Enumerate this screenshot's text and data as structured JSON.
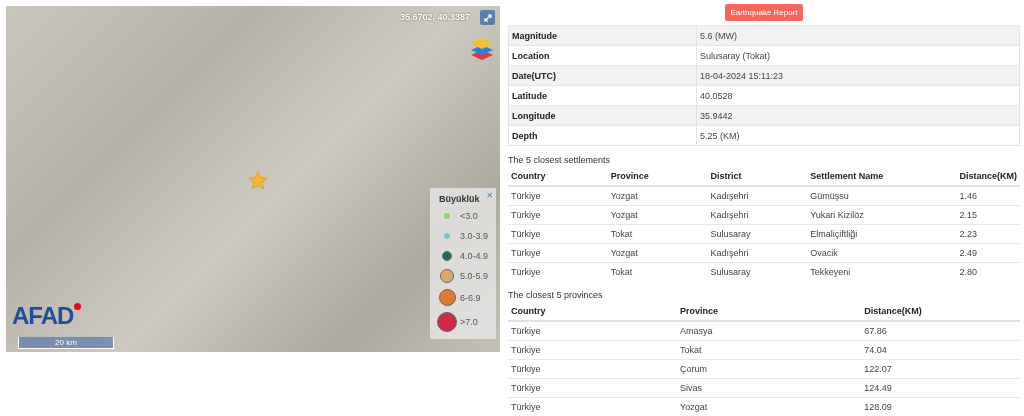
{
  "map": {
    "coordinates": "35.6702, 40.3387",
    "logo": "AFAD",
    "scale": "20 km",
    "legend": {
      "title": "Büyüklük",
      "close": "×",
      "items": [
        {
          "label": "<3.0",
          "color": "#8fd36b"
        },
        {
          "label": "3.0-3.9",
          "color": "#7fc3c9"
        },
        {
          "label": "4.0-4.9",
          "color": "#1f6b5a"
        },
        {
          "label": "5.0-5.9",
          "color": "#d8ab6c"
        },
        {
          "label": "6-6.9",
          "color": "#dd7a35"
        },
        {
          "label": ">7.0",
          "color": "#cc2a45"
        }
      ]
    }
  },
  "report_button": "Earthquake Report",
  "details": [
    {
      "label": "Magnitude",
      "value": "5.6 (MW)"
    },
    {
      "label": "Location",
      "value": "Sulusaray (Tokat)"
    },
    {
      "label": "Date(UTC)",
      "value": "18-04-2024 15:11:23"
    },
    {
      "label": "Latitude",
      "value": "40.0528"
    },
    {
      "label": "Longitude",
      "value": "35.9442"
    },
    {
      "label": "Depth",
      "value": "5.25 (KM)"
    }
  ],
  "settlements": {
    "title": "The 5 closest settlements",
    "columns": [
      "Country",
      "Province",
      "District",
      "Settlement Name",
      "Distance(KM)"
    ],
    "rows": [
      [
        "Türkiye",
        "Yozgat",
        "Kadışehri",
        "Gümüşsu",
        "1.46"
      ],
      [
        "Türkiye",
        "Yozgat",
        "Kadışehri",
        "Yukari Kizilöz",
        "2.15"
      ],
      [
        "Türkiye",
        "Tokat",
        "Sulusaray",
        "Elmaliçiftliği",
        "2.23"
      ],
      [
        "Türkiye",
        "Yozgat",
        "Kadışehri",
        "Ovacik",
        "2.49"
      ],
      [
        "Türkiye",
        "Tokat",
        "Sulusaray",
        "Tekkeyeni",
        "2.80"
      ]
    ]
  },
  "provinces": {
    "title": "The closest 5 provinces",
    "columns": [
      "Country",
      "Province",
      "Distance(KM)"
    ],
    "rows": [
      [
        "Türkiye",
        "Amasya",
        "67.86"
      ],
      [
        "Türkiye",
        "Tokat",
        "74.04"
      ],
      [
        "Türkiye",
        "Çorum",
        "122.07"
      ],
      [
        "Türkiye",
        "Sivas",
        "124.49"
      ],
      [
        "Türkiye",
        "Yozgat",
        "128.09"
      ]
    ]
  }
}
